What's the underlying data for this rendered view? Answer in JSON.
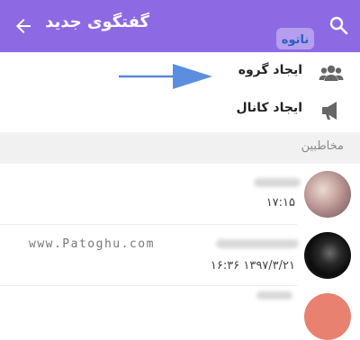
{
  "app_bar": {
    "title": "گفتگوی جدید",
    "back_icon": "arrow-back-icon",
    "search_icon": "search-icon",
    "background_color": "#8d6ae4"
  },
  "logo": {
    "text": "ناتوه"
  },
  "actions": [
    {
      "label": "ایجاد گروه",
      "icon": "group-icon"
    },
    {
      "label": "ایجاد کانال",
      "icon": "megaphone-icon"
    }
  ],
  "section": {
    "title": "مخاطبین"
  },
  "contacts": [
    {
      "time": "۱۷:۱۵"
    },
    {
      "time": "۱۳۹۷/۳/۲۱ ۱۶:۳۶"
    }
  ],
  "watermark": "www.Patoghu.com"
}
